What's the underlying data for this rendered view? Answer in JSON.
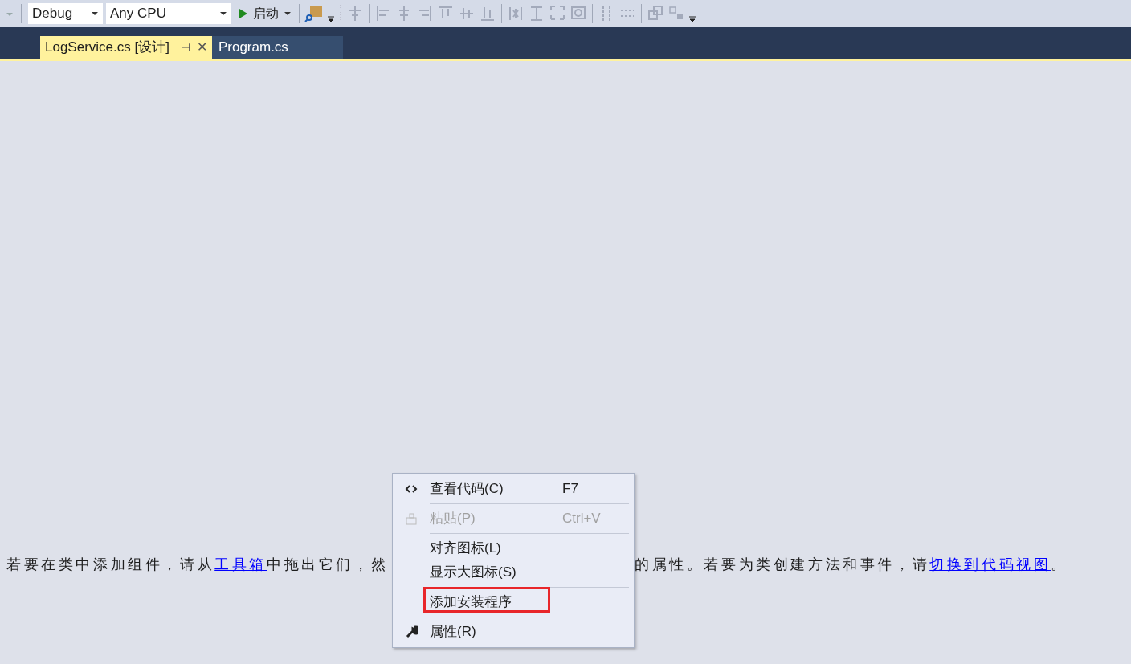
{
  "toolbar": {
    "configuration": "Debug",
    "platform": "Any CPU",
    "start_button": "启动"
  },
  "tabs": [
    {
      "label": "LogService.cs [设计]",
      "selected": true,
      "pin": "⊣",
      "close": "✕"
    },
    {
      "label": "Program.cs",
      "selected": false
    }
  ],
  "designer_hint": {
    "left": [
      {
        "text": "若要在类中添加组件，请从",
        "link": false
      },
      {
        "text": "工具箱",
        "link": true
      },
      {
        "text": "中拖出它们，然",
        "link": false
      }
    ],
    "right": [
      {
        "text": "的属性。若要为类创建方法和事件，请",
        "link": false
      },
      {
        "text": "切换到代码视图",
        "link": true
      },
      {
        "text": "。",
        "link": false
      }
    ]
  },
  "context_menu": [
    {
      "kind": "item",
      "label": "查看代码(C)",
      "shortcut": "F7",
      "disabled": false,
      "boxed": false
    },
    {
      "kind": "separator"
    },
    {
      "kind": "item",
      "label": "粘贴(P)",
      "shortcut": "Ctrl+V",
      "disabled": true,
      "boxed": false
    },
    {
      "kind": "separator"
    },
    {
      "kind": "item",
      "label": "对齐图标(L)",
      "disabled": false,
      "boxed": false
    },
    {
      "kind": "item",
      "label": "显示大图标(S)",
      "disabled": false,
      "boxed": false
    },
    {
      "kind": "separator"
    },
    {
      "kind": "item",
      "label": "添加安装程序",
      "disabled": false,
      "boxed": true
    },
    {
      "kind": "separator"
    },
    {
      "kind": "item",
      "label": "属性(R)",
      "disabled": false,
      "boxed": false
    }
  ]
}
